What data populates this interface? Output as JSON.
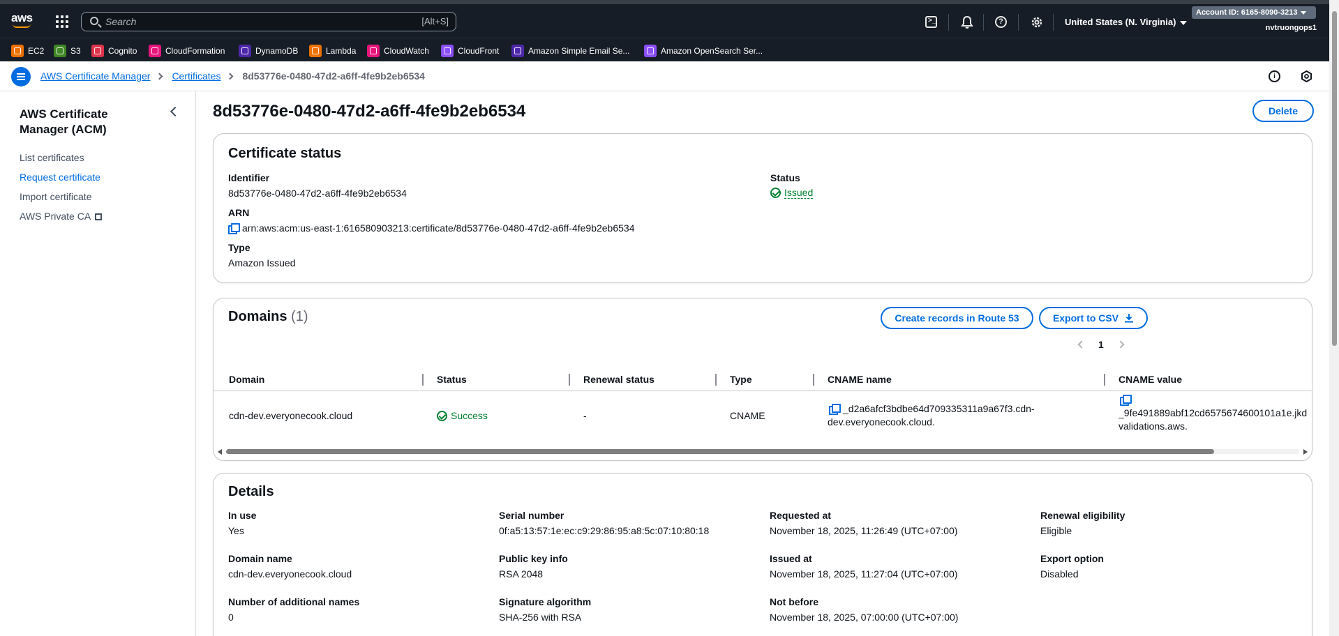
{
  "topbar": {
    "logo_text": "aws",
    "search_placeholder": "Search",
    "search_shortcut": "[Alt+S]",
    "region": "United States (N. Virginia)",
    "account_id": "Account ID: 6165-8090-3213",
    "username": "nvtruongops1"
  },
  "favorites": [
    {
      "label": "EC2",
      "color": "#ed7100"
    },
    {
      "label": "S3",
      "color": "#3f8624"
    },
    {
      "label": "Cognito",
      "color": "#dd344c"
    },
    {
      "label": "CloudFormation",
      "color": "#e7157b"
    },
    {
      "label": "DynamoDB",
      "color": "#4d27aa"
    },
    {
      "label": "Lambda",
      "color": "#ed7100"
    },
    {
      "label": "CloudWatch",
      "color": "#e7157b"
    },
    {
      "label": "CloudFront",
      "color": "#8c4fff"
    },
    {
      "label": "Amazon Simple Email Se...",
      "color": "#4d27aa"
    },
    {
      "label": "Amazon OpenSearch Ser...",
      "color": "#8c4fff"
    }
  ],
  "breadcrumb": {
    "items": [
      "AWS Certificate Manager",
      "Certificates"
    ],
    "current": "8d53776e-0480-47d2-a6ff-4fe9b2eb6534"
  },
  "sidebar": {
    "title": "AWS Certificate Manager (ACM)",
    "links": [
      "List certificates",
      "Request certificate",
      "Import certificate",
      "AWS Private CA"
    ]
  },
  "page": {
    "title": "8d53776e-0480-47d2-a6ff-4fe9b2eb6534",
    "delete_label": "Delete"
  },
  "cert_status": {
    "title": "Certificate status",
    "identifier_label": "Identifier",
    "identifier": "8d53776e-0480-47d2-a6ff-4fe9b2eb6534",
    "arn_label": "ARN",
    "arn": "arn:aws:acm:us-east-1:616580903213:certificate/8d53776e-0480-47d2-a6ff-4fe9b2eb6534",
    "type_label": "Type",
    "type": "Amazon Issued",
    "status_label": "Status",
    "status": "Issued"
  },
  "domains": {
    "title": "Domains",
    "count": "(1)",
    "route53_label": "Create records in Route 53",
    "export_label": "Export to CSV",
    "page_number": "1",
    "columns": [
      "Domain",
      "Status",
      "Renewal status",
      "Type",
      "CNAME name",
      "CNAME value"
    ],
    "rows": [
      {
        "domain": "cdn-dev.everyonecook.cloud",
        "status": "Success",
        "renewal_status": "-",
        "type": "CNAME",
        "cname_name_1": "_d2a6afcf3bdbe64d709335311a9a67f3.cdn-",
        "cname_name_2": "dev.everyonecook.cloud.",
        "cname_value_1": "_9fe491889abf12cd6575674600101a1e.jkd",
        "cname_value_2": "validations.aws."
      }
    ]
  },
  "details": {
    "title": "Details",
    "fields": [
      {
        "label": "In use",
        "value": "Yes"
      },
      {
        "label": "Serial number",
        "value": "0f:a5:13:57:1e:ec:c9:29:86:95:a8:5c:07:10:80:18"
      },
      {
        "label": "Requested at",
        "value": "November 18, 2025, 11:26:49 (UTC+07:00)"
      },
      {
        "label": "Renewal eligibility",
        "value": "Eligible"
      },
      {
        "label": "Domain name",
        "value": "cdn-dev.everyonecook.cloud"
      },
      {
        "label": "Public key info",
        "value": "RSA 2048"
      },
      {
        "label": "Issued at",
        "value": "November 18, 2025, 11:27:04 (UTC+07:00)"
      },
      {
        "label": "Export option",
        "value": "Disabled"
      },
      {
        "label": "Number of additional names",
        "value": "0"
      },
      {
        "label": "Signature algorithm",
        "value": "SHA-256 with RSA"
      },
      {
        "label": "Not before",
        "value": "November 18, 2025, 07:00:00 (UTC+07:00)"
      }
    ]
  },
  "colors": {
    "topbar_bg": "#161d26",
    "link": "#006ce0",
    "success": "#00802f"
  }
}
